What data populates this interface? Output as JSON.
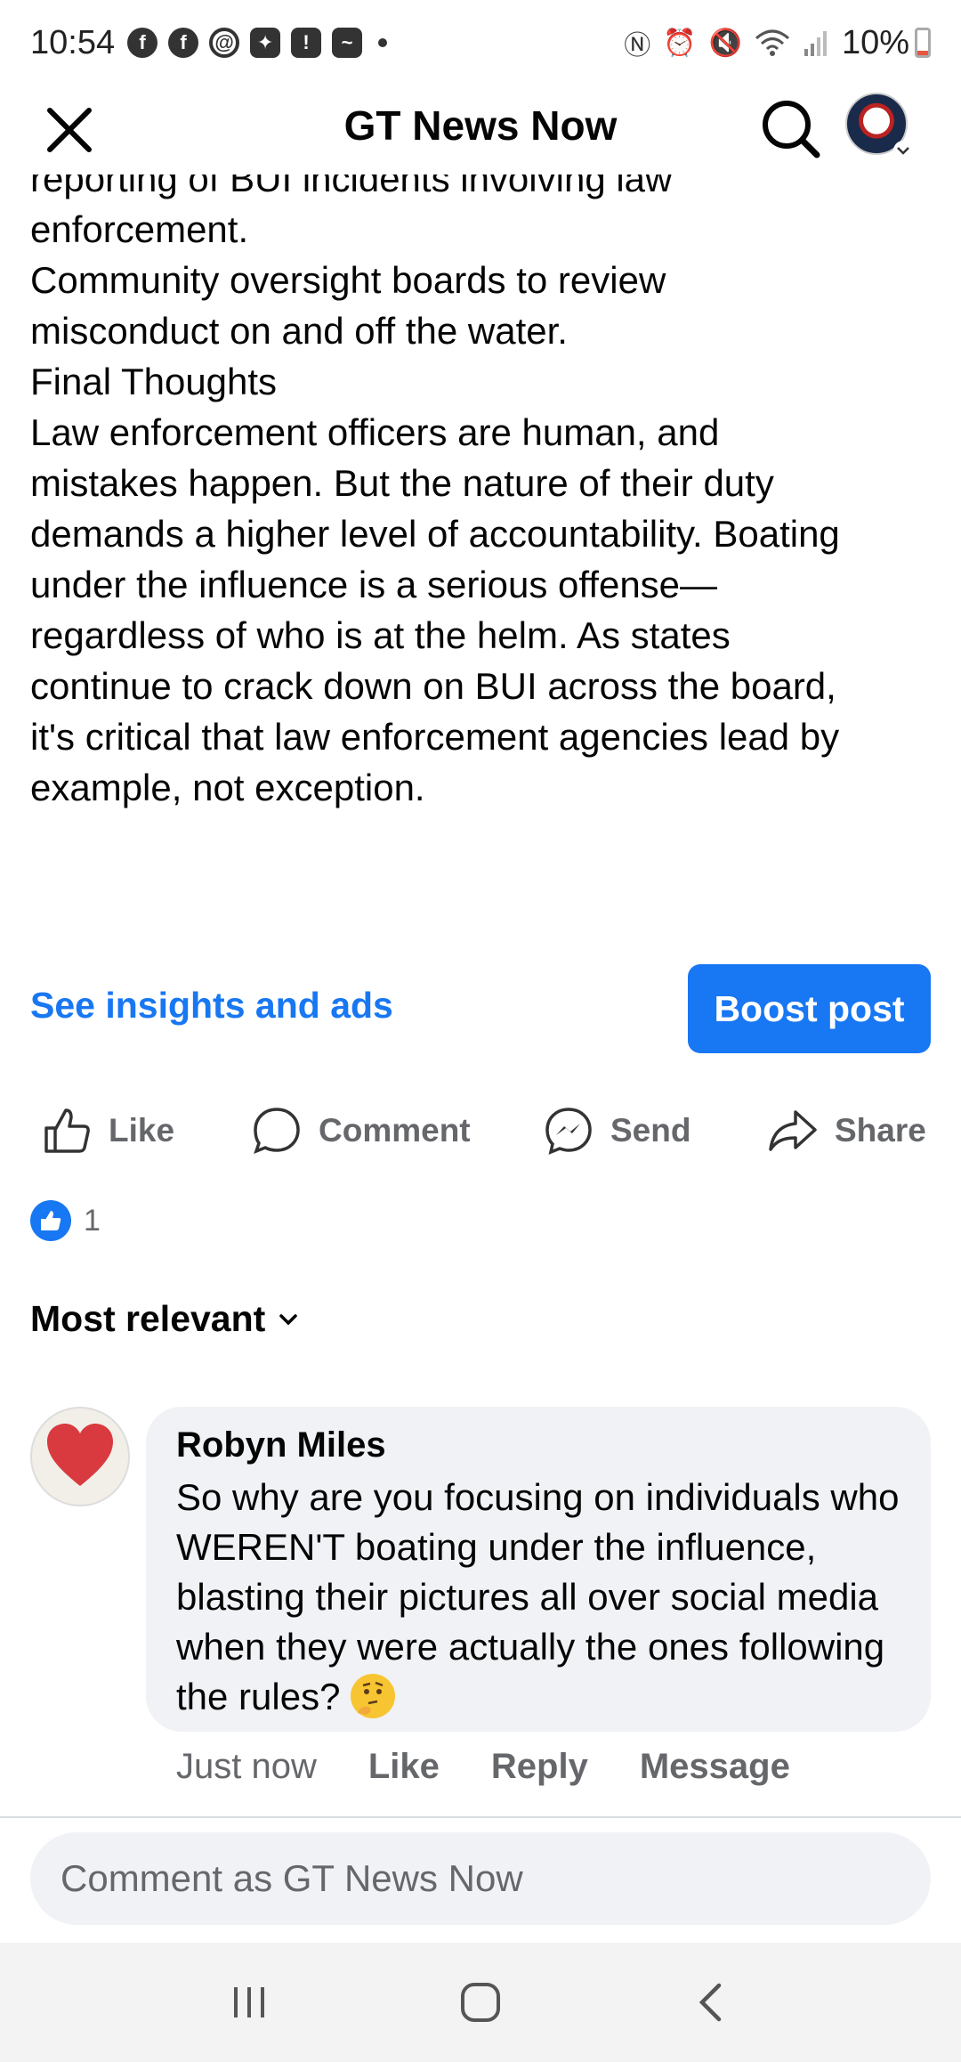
{
  "status_bar": {
    "time": "10:54",
    "battery": "10%",
    "left_icons": [
      "facebook-icon",
      "facebook-icon",
      "threads-icon",
      "gamepad-icon",
      "alert-icon",
      "app-icon"
    ],
    "right_icons": [
      "nfc-icon",
      "alarm-icon",
      "mute-icon",
      "wifi-icon",
      "signal-icon"
    ]
  },
  "header": {
    "title": "GT News Now"
  },
  "article": {
    "clipped_line": "reporting of BUI incidents involving law",
    "lines": [
      "enforcement.",
      "",
      "Community oversight boards to review",
      "misconduct on and off the water.",
      "",
      "Final Thoughts",
      "Law enforcement officers are human, and",
      "mistakes happen. But the nature of their duty",
      "demands a higher level of accountability. Boating",
      "under the influence is a serious offense—",
      "regardless of who is at the helm. As states",
      "continue to crack down on BUI across the board,",
      "it's critical that law enforcement agencies lead by",
      "example, not exception."
    ]
  },
  "insights_link": "See insights and ads",
  "boost_button": "Boost post",
  "actions": {
    "like": "Like",
    "comment": "Comment",
    "send": "Send",
    "share": "Share"
  },
  "reactions": {
    "count": "1"
  },
  "sort": {
    "label": "Most relevant"
  },
  "comment": {
    "author": "Robyn Miles",
    "text": "So why are you focusing on individuals who WEREN'T boating under the influence, blasting their pictures all over social media when they were actually the ones following the rules?",
    "time": "Just now",
    "like": "Like",
    "reply": "Reply",
    "message": "Message"
  },
  "composer": {
    "placeholder": "Comment as GT News Now"
  },
  "colors": {
    "accent": "#1877f2",
    "secondary_text": "#65676b",
    "bubble": "#f0f2f5"
  }
}
